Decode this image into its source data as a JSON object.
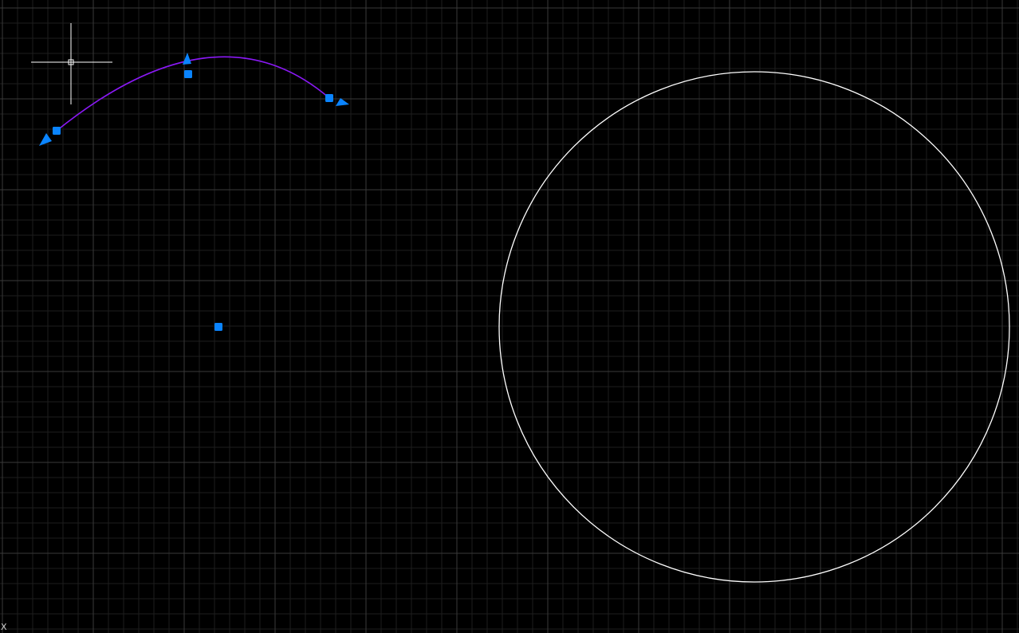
{
  "colors": {
    "background": "#000000",
    "grid_minor": "#1e1e1e",
    "grid_major": "#3a3a3a",
    "arc": "#8a19f5",
    "circle": "#ffffff",
    "grip": "#0a84ff",
    "crosshair": "#ffffff"
  },
  "icons": {
    "crosshair": "crosshair-cursor-icon",
    "grip_square": "square-grip-icon",
    "grip_arrow": "triangle-arrow-grip-icon"
  },
  "canvas": {
    "ucs_axis_label": "X"
  }
}
